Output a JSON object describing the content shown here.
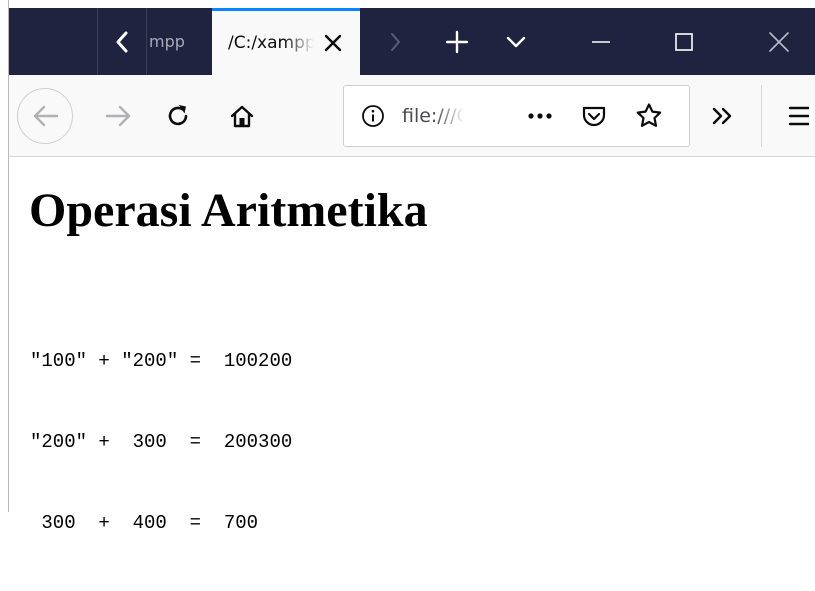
{
  "browser": {
    "tabs": [
      {
        "label": "mpp",
        "active": false
      },
      {
        "label": "/C:/xampp",
        "active": true
      }
    ],
    "url": "file:///C:/xampp",
    "colors": {
      "tabbar": "#202340",
      "accent": "#0a84ff",
      "toolbar": "#f9f9fa"
    }
  },
  "icons": {
    "tab_scroll_left": "chevron-left-icon",
    "tab_close": "close-icon",
    "tab_scroll_right": "chevron-right-icon",
    "new_tab": "plus-icon",
    "all_tabs": "chevron-down-icon",
    "minimize": "minimize-icon",
    "maximize": "maximize-icon",
    "close_window": "close-icon",
    "back": "arrow-left-icon",
    "forward": "arrow-right-icon",
    "reload": "reload-icon",
    "home": "home-icon",
    "site_info": "info-icon",
    "page_actions": "ellipsis-icon",
    "pocket": "pocket-icon",
    "bookmark": "star-icon",
    "overflow": "double-chevron-right-icon",
    "menu": "hamburger-icon"
  },
  "page": {
    "title": "Operasi Aritmetika",
    "lines": [
      "\"100\" + \"200\" =  100200",
      "\"200\" +  300  =  200300",
      " 300  +  400  =  700"
    ]
  }
}
